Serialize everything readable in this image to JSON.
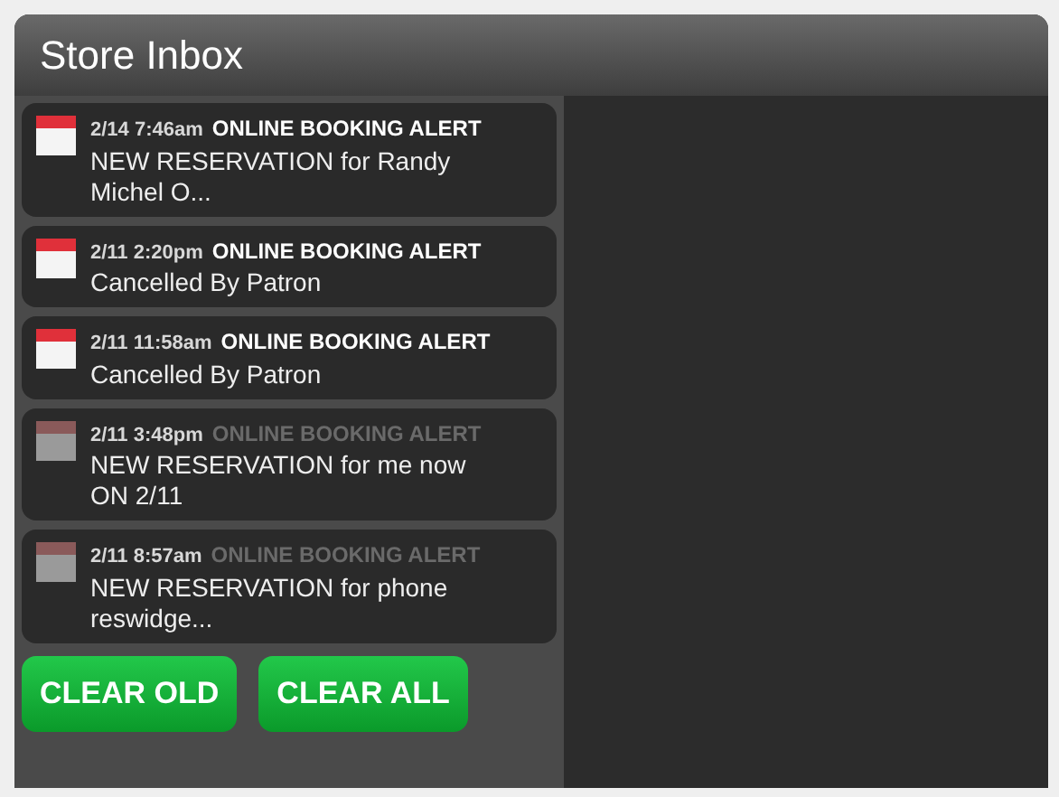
{
  "title": "Store Inbox",
  "messages": [
    {
      "time": "2/14 7:46am",
      "subject": "ONLINE BOOKING ALERT",
      "body": "NEW RESERVATION for Randy Michel O...",
      "read": false
    },
    {
      "time": "2/11 2:20pm",
      "subject": "ONLINE BOOKING ALERT",
      "body": "Cancelled By Patron",
      "read": false
    },
    {
      "time": "2/11 11:58am",
      "subject": "ONLINE BOOKING ALERT",
      "body": "Cancelled By Patron",
      "read": false
    },
    {
      "time": "2/11 3:48pm",
      "subject": "ONLINE BOOKING ALERT",
      "body": "NEW RESERVATION for me now ON 2/11",
      "read": true
    },
    {
      "time": "2/11 8:57am",
      "subject": "ONLINE BOOKING ALERT",
      "body": "NEW RESERVATION for phone reswidge...",
      "read": true
    }
  ],
  "buttons": [
    "CLEAR OLD",
    "CLEAR ALL"
  ]
}
